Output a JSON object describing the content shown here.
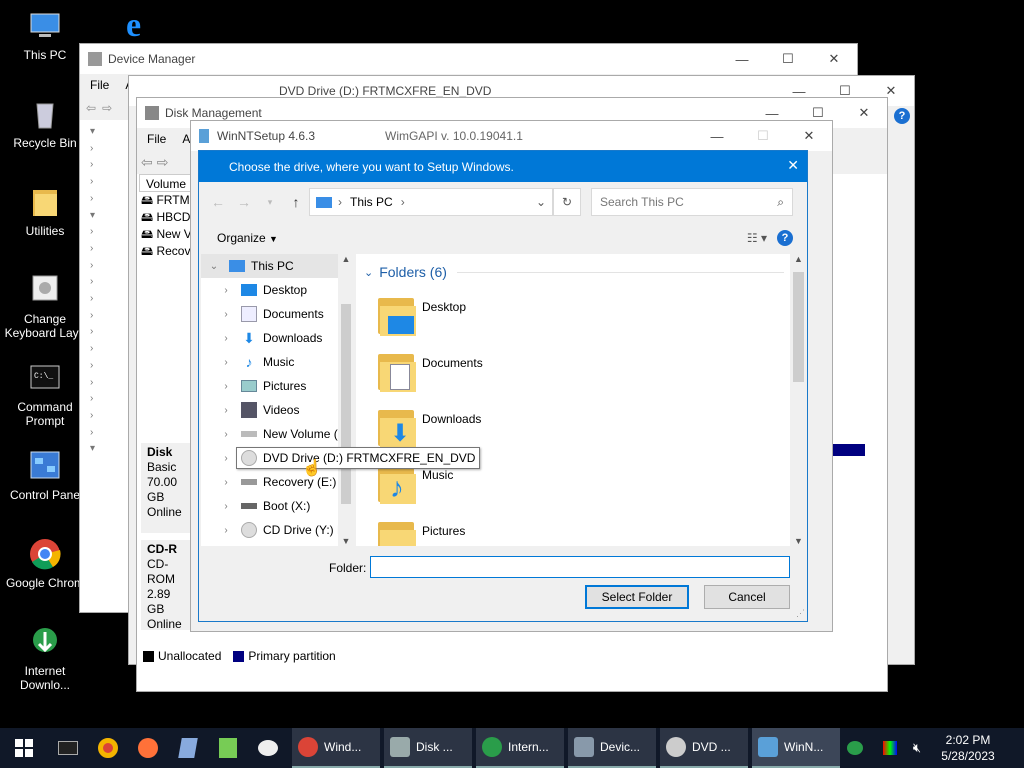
{
  "desktop": {
    "icons": [
      {
        "label": "This PC"
      },
      {
        "label": "Recycle Bin"
      },
      {
        "label": "Utilities"
      },
      {
        "label": "Change Keyboard Layo"
      },
      {
        "label": "Command Prompt"
      },
      {
        "label": "Control Pane"
      },
      {
        "label": "Google Chrom"
      },
      {
        "label": "Internet Downlo..."
      }
    ]
  },
  "device_manager": {
    "title": "Device Manager",
    "menu_file": "File",
    "menu_a": "A"
  },
  "dvd_window": {
    "title": "DVD Drive (D:) FRTMCXFRE_EN_DVD"
  },
  "disk_mgmt": {
    "title": "Disk Management",
    "menu_file": "File",
    "menu_a": "Ac",
    "col_volume": "Volume",
    "volumes": [
      "FRTMC",
      "HBCD",
      "New V",
      "Recov"
    ],
    "disk0": {
      "name": "Disk",
      "type": "Basic",
      "size": "70.00 GB",
      "status": "Online"
    },
    "cd": {
      "name": "CD-R",
      "type": "CD-ROM",
      "size": "2.89 GB",
      "status": "Online"
    },
    "legend_unallocated": "Unallocated",
    "legend_primary": "Primary partition"
  },
  "winntsetup": {
    "title": "WinNTSetup 4.6.3",
    "wimgapi": "WimGAPI v. 10.0.19041.1"
  },
  "dialog": {
    "title": "Choose the drive, where you want to Setup Windows.",
    "address_root": "This PC",
    "search_placeholder": "Search This PC",
    "organize": "Organize",
    "tree": [
      {
        "label": "This PC"
      },
      {
        "label": "Desktop"
      },
      {
        "label": "Documents"
      },
      {
        "label": "Downloads"
      },
      {
        "label": "Music"
      },
      {
        "label": "Pictures"
      },
      {
        "label": "Videos"
      },
      {
        "label": "New Volume (C"
      },
      {
        "label": "DVD Drive (D:) FRTMCXFRE_EN_DVD"
      },
      {
        "label": "Recovery (E:)"
      },
      {
        "label": "Boot (X:)"
      },
      {
        "label": "CD Drive (Y:) H"
      }
    ],
    "folders_header": "Folders (6)",
    "folders": [
      {
        "label": "Desktop"
      },
      {
        "label": "Documents"
      },
      {
        "label": "Downloads"
      },
      {
        "label": "Music"
      },
      {
        "label": "Pictures"
      }
    ],
    "folder_label": "Folder:",
    "folder_value": "",
    "select_button": "Select Folder",
    "cancel_button": "Cancel"
  },
  "taskbar": {
    "tasks": [
      {
        "label": "Wind...",
        "color": "#db4437"
      },
      {
        "label": "Disk ...",
        "color": "#9aa"
      },
      {
        "label": "Intern...",
        "color": "#2a9d4a"
      },
      {
        "label": "Devic...",
        "color": "#8899aa"
      },
      {
        "label": "DVD ...",
        "color": "#ccc"
      },
      {
        "label": "WinN...",
        "color": "#5aa0d8"
      }
    ],
    "time": "2:02 PM",
    "date": "5/28/2023"
  },
  "colors": {
    "accent": "#0078d7",
    "folder": "#f8d775"
  }
}
